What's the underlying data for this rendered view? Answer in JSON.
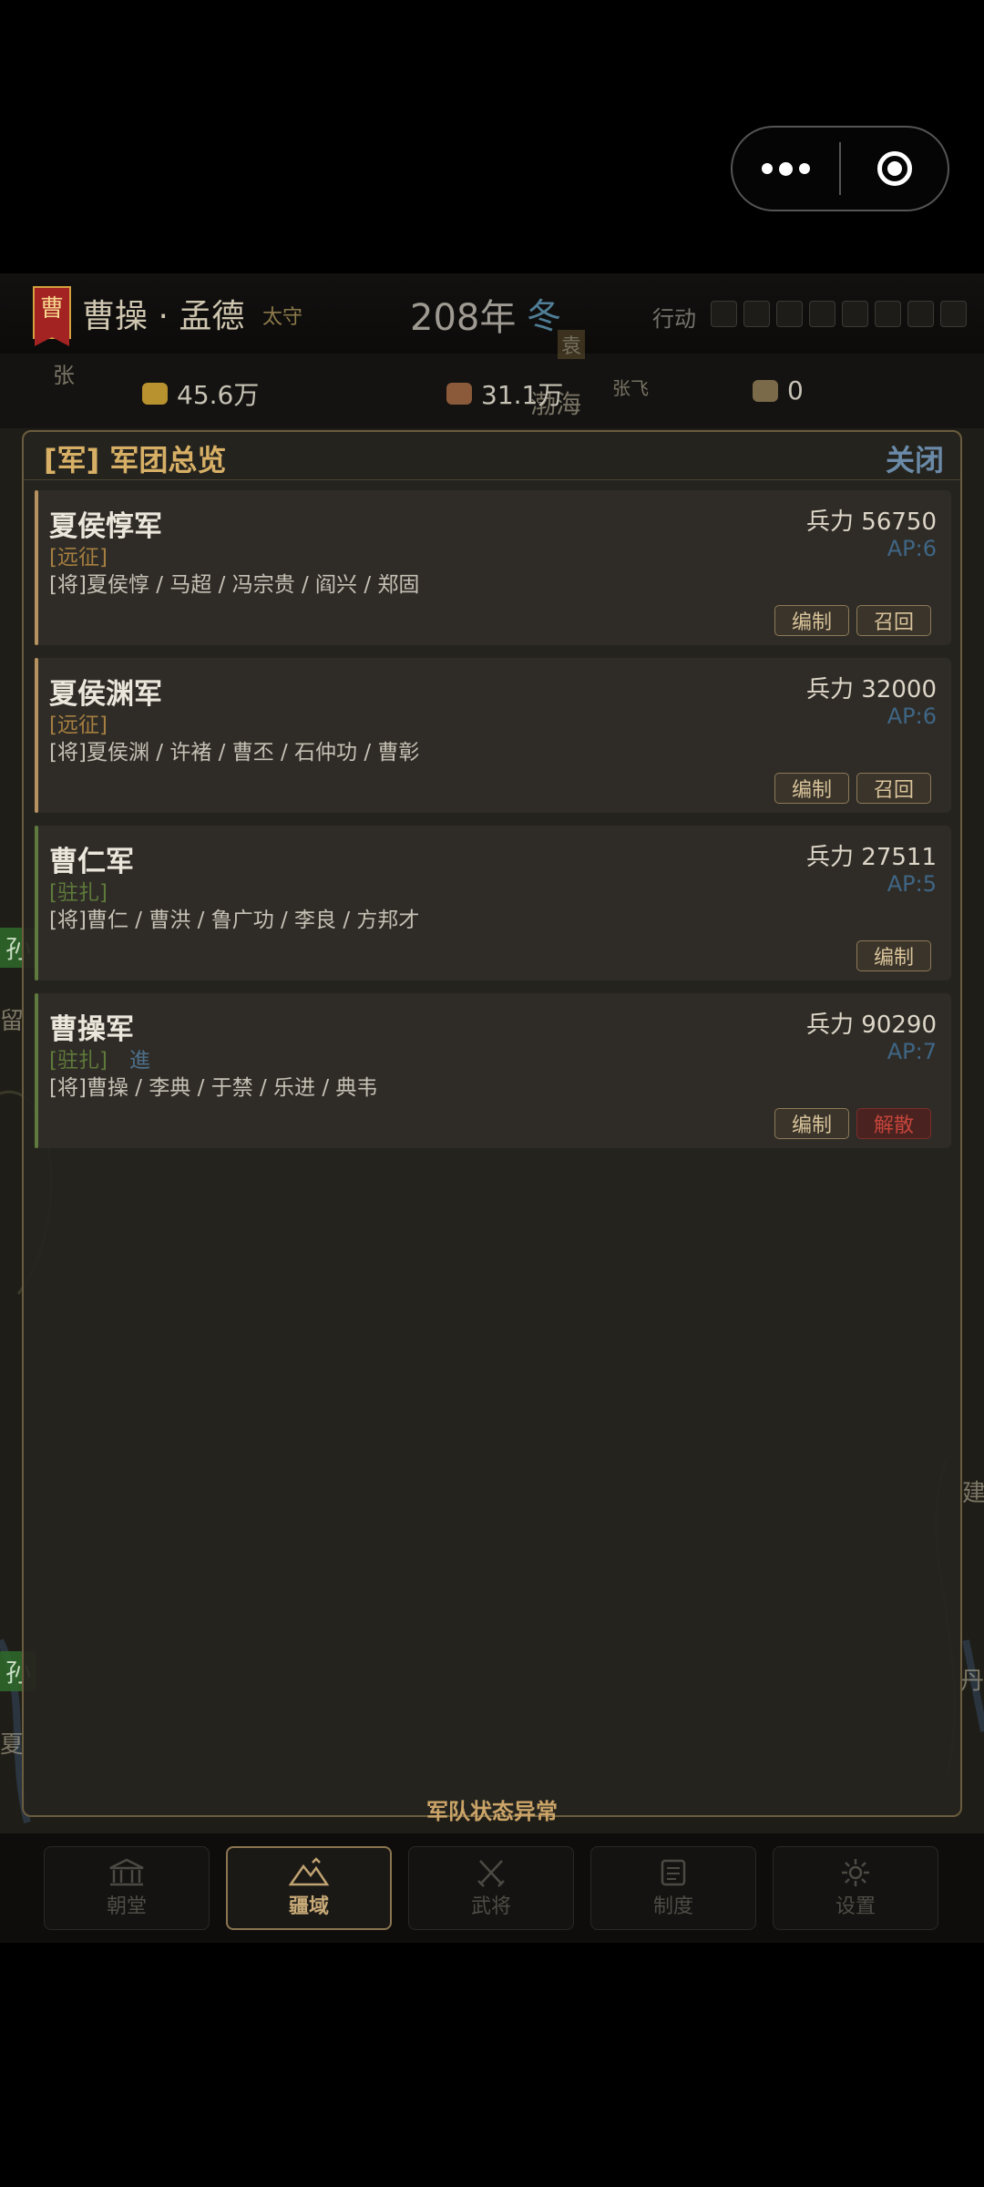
{
  "topbar": {
    "banner_char": "曹",
    "ruler_name": "曹操 · 孟德",
    "ruler_title": "太守",
    "year": "208年",
    "season": "冬",
    "action_label": "行动"
  },
  "resources": {
    "gold": "45.6万",
    "food": "31.1万",
    "horse": "0"
  },
  "map_labels": {
    "zhang": "张",
    "bohai": "渤海",
    "zhangfei": "张飞",
    "sun1": "孙",
    "liu": "留",
    "sun2": "孙",
    "xia": "夏",
    "jian": "建",
    "dan": "丹",
    "yuan": "袁"
  },
  "modal": {
    "title": "[军] 军团总览",
    "close_label": "关闭",
    "footer_note": "军队状态异常"
  },
  "armies": [
    {
      "name": "夏侯惇军",
      "status": "[远征]",
      "extra": "",
      "generals": "[将]夏侯惇 / 马超 / 冯宗贵 / 阎兴 / 郑固",
      "troops": "兵力 56750",
      "ap": "AP:6",
      "buttons": [
        "编制",
        "召回"
      ]
    },
    {
      "name": "夏侯渊军",
      "status": "[远征]",
      "extra": "",
      "generals": "[将]夏侯渊 / 许褚 / 曹丕 / 石仲功 / 曹彰",
      "troops": "兵力 32000",
      "ap": "AP:6",
      "buttons": [
        "编制",
        "召回"
      ]
    },
    {
      "name": "曹仁军",
      "status": "[驻扎]",
      "extra": "",
      "generals": "[将]曹仁 / 曹洪 / 鲁广功 / 李良 / 方邦才",
      "troops": "兵力 27511",
      "ap": "AP:5",
      "buttons": [
        "编制"
      ]
    },
    {
      "name": "曹操军",
      "status": "[驻扎]",
      "extra": "進",
      "generals": "[将]曹操 / 李典 / 于禁 / 乐进 / 典韦",
      "troops": "兵力 90290",
      "ap": "AP:7",
      "buttons": [
        "编制",
        "解散"
      ]
    }
  ],
  "nav": [
    {
      "label": "朝堂",
      "icon": "court-hall-icon",
      "active": false
    },
    {
      "label": "疆域",
      "icon": "territory-mountain-icon",
      "active": true
    },
    {
      "label": "武将",
      "icon": "crossed-swords-icon",
      "active": false
    },
    {
      "label": "制度",
      "icon": "scroll-icon",
      "active": false
    },
    {
      "label": "设置",
      "icon": "gear-icon",
      "active": false
    }
  ],
  "colors": {
    "expedition_status": "#a57e40",
    "garrison_status": "#5e7a3a",
    "expedition_accent": "#b59260",
    "garrison_accent": "#5f7a3e",
    "title_gold": "#d7b066",
    "close_blue": "#6a8aa8",
    "ap_blue": "#3f6685",
    "danger_red": "#c6443b"
  }
}
